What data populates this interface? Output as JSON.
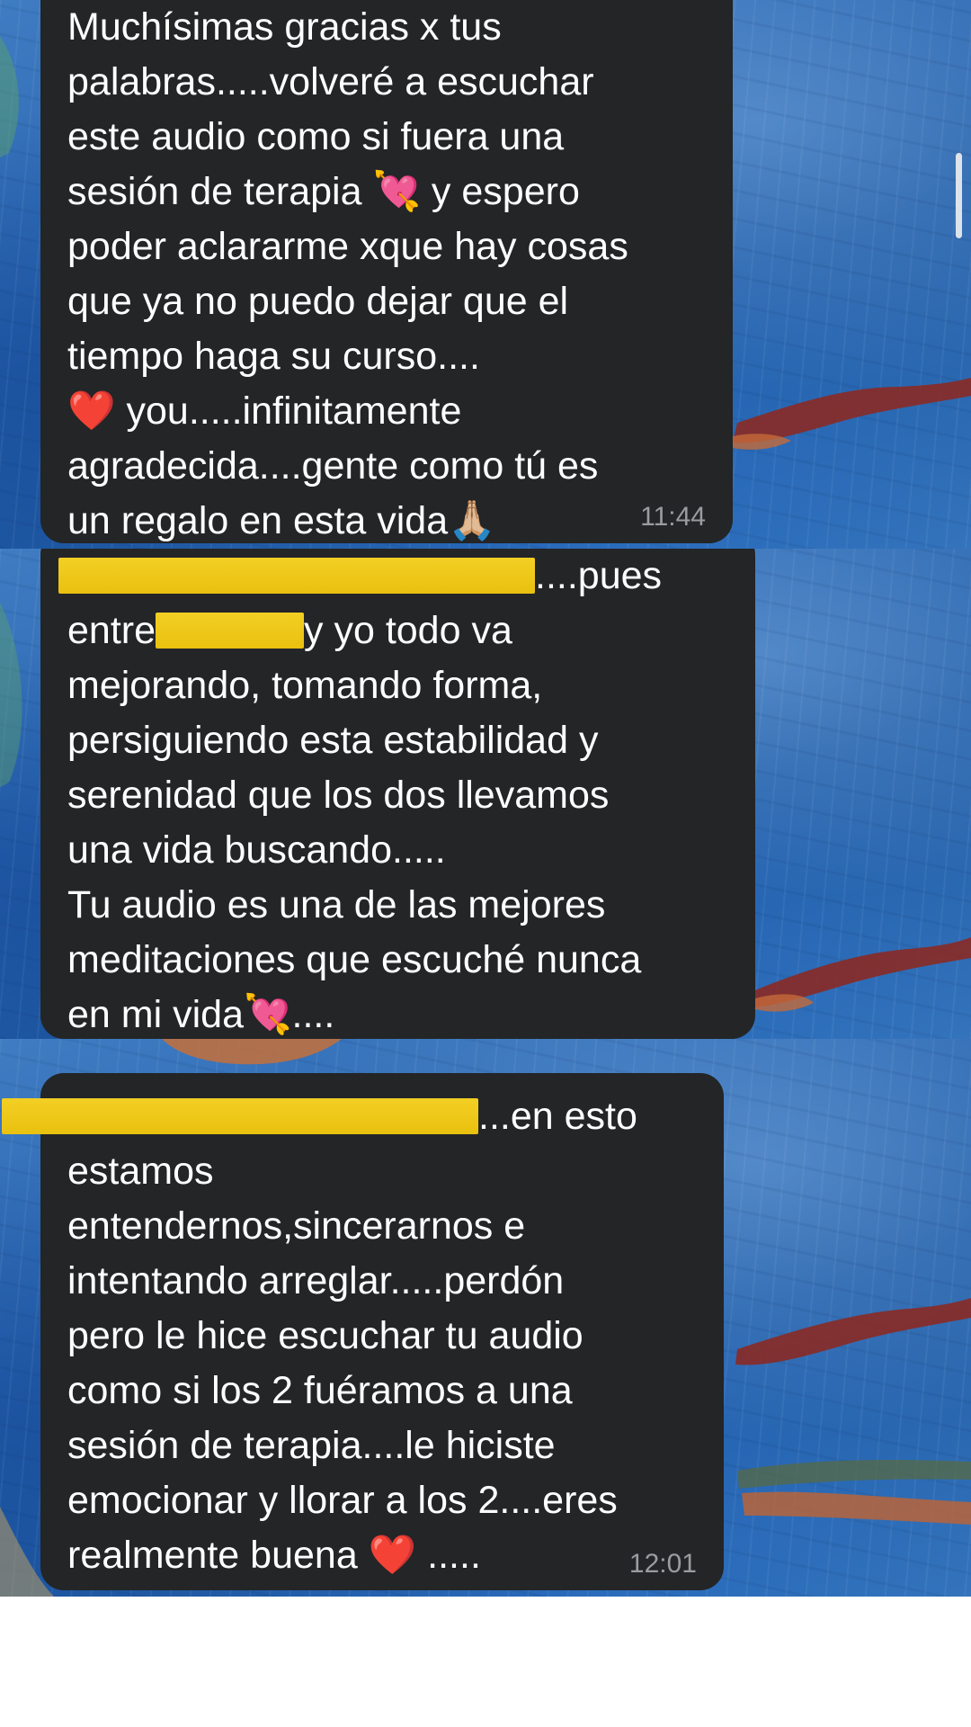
{
  "messages": [
    {
      "lines": [
        "Muchísimas gracias x tus",
        "palabras.....volveré a escuchar",
        "este audio como si fuera una",
        "sesión de terapia 💘 y espero",
        "poder aclararme xque hay cosas",
        "que ya no puedo dejar que el",
        "tiempo haga su curso....",
        "❤️ you.....infinitamente",
        "agradecida....gente como tú es",
        "un regalo en esta vida🙏🏼"
      ],
      "time": "11:44"
    },
    {
      "line1_after_redaction": "....pues",
      "line2_before": "entre",
      "line2_after": "y yo todo va",
      "lines": [
        "mejorando, tomando forma,",
        "persiguiendo esta estabilidad y",
        "serenidad que los dos llevamos",
        "una vida buscando.....",
        "Tu audio es una de las mejores",
        "meditaciones que escuché nunca",
        "en mi vida💘...."
      ]
    },
    {
      "line1_after_redaction": "...en esto",
      "lines": [
        "estamos",
        "entendernos,sincerarnos e",
        "intentando arreglar.....perdón",
        "pero le hice escuchar tu audio",
        "como si los 2 fuéramos a una",
        "sesión de terapia....le hiciste",
        "emocionar y llorar a los 2....eres",
        "realmente buena ❤️ ....."
      ],
      "time": "12:01"
    }
  ],
  "colors": {
    "bubble": "#232527",
    "text": "#ffffff",
    "time": "#9a9c9f",
    "redaction": "#f3cf24",
    "background": "#2a66b0"
  }
}
